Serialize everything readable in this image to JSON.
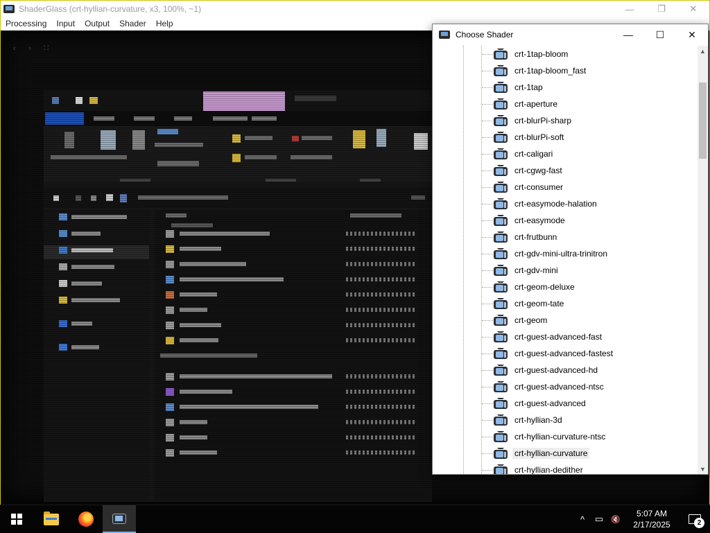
{
  "main_window": {
    "title": "ShaderGlass (crt-hyllian-curvature, x3, 100%, ~1)",
    "controls": {
      "minimize": "—",
      "maximize": "❐",
      "close": "✕"
    },
    "menu": [
      "Processing",
      "Input",
      "Output",
      "Shader",
      "Help"
    ]
  },
  "dialog": {
    "title": "Choose Shader",
    "controls": {
      "minimize": "—",
      "maximize": "☐",
      "close": "✕"
    },
    "selected": "crt-hyllian-curvature",
    "shaders": [
      "crt-1tap-bloom",
      "crt-1tap-bloom_fast",
      "crt-1tap",
      "crt-aperture",
      "crt-blurPi-sharp",
      "crt-blurPi-soft",
      "crt-caligari",
      "crt-cgwg-fast",
      "crt-consumer",
      "crt-easymode-halation",
      "crt-easymode",
      "crt-frutbunn",
      "crt-gdv-mini-ultra-trinitron",
      "crt-gdv-mini",
      "crt-geom-deluxe",
      "crt-geom-tate",
      "crt-geom",
      "crt-guest-advanced-fast",
      "crt-guest-advanced-fastest",
      "crt-guest-advanced-hd",
      "crt-guest-advanced-ntsc",
      "crt-guest-advanced",
      "crt-hyllian-3d",
      "crt-hyllian-curvature-ntsc",
      "crt-hyllian-curvature",
      "crt-hyllian-dedither"
    ],
    "scroll": {
      "up": "▲",
      "down": "▼"
    }
  },
  "taskbar": {
    "apps": [
      "start-icon",
      "file-explorer-icon",
      "firefox-icon",
      "shaderglass-icon"
    ],
    "tray": {
      "chevron": "^",
      "network": "▭",
      "volume_muted": "🔇"
    },
    "time": "5:07 AM",
    "date": "2/17/2025",
    "notification_count": "2"
  }
}
